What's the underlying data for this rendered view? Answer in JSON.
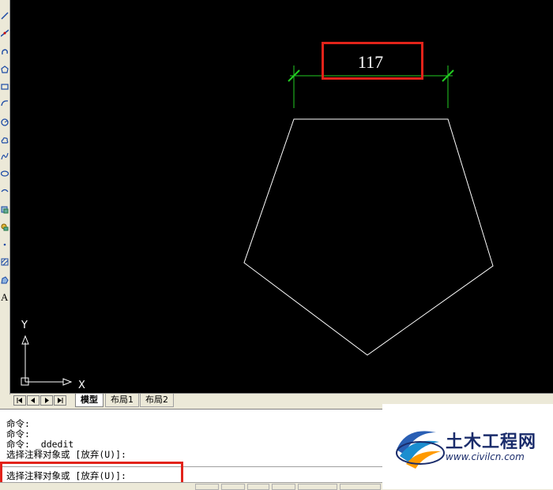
{
  "colors": {
    "canvas_background": "#000000",
    "pentagon_stroke": "#ffffff",
    "dimension_color": "#22cc22",
    "highlight_red": "#e2231a",
    "ucs_color": "#ffffff"
  },
  "drawing": {
    "dimension_value": "117",
    "ucs_y_label": "Y",
    "ucs_x_label": "X"
  },
  "tabs": {
    "model": "模型",
    "layout1": "布局1",
    "layout2": "布局2"
  },
  "command_window": {
    "history": [
      "命令:",
      "命令:",
      "命令: _ddedit",
      "选择注释对象或 [放弃(U)]:"
    ],
    "current_prompt": "选择注释对象或 [放弃(U)]:"
  },
  "toolbar_icons": [
    "line-icon",
    "construction-line-icon",
    "polyline-icon",
    "polygon-icon",
    "rectangle-icon",
    "arc-icon",
    "circle-icon",
    "revision-cloud-icon",
    "spline-icon",
    "ellipse-icon",
    "ellipse-arc-icon",
    "insert-block-icon",
    "make-block-icon",
    "point-icon",
    "hatch-icon",
    "region-icon",
    "multiline-text-icon"
  ],
  "watermark": {
    "brand": "土木工程网",
    "url": "www.civilcn.com"
  }
}
